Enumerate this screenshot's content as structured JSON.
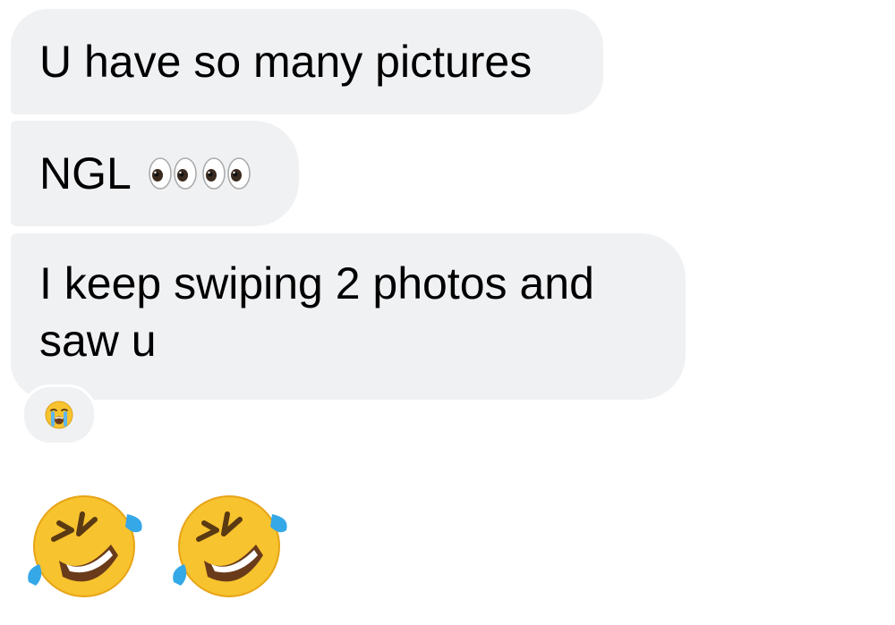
{
  "messages": [
    {
      "text": "U have so many pictures"
    },
    {
      "text": "NGL",
      "emojis": [
        "eyes-emoji",
        "eyes-emoji"
      ]
    },
    {
      "text": "I keep swiping 2 photos and saw u"
    }
  ],
  "reaction": {
    "emoji": "loudly-crying-face-emoji"
  },
  "emoji_message": {
    "emojis": [
      "rolling-on-floor-laughing-emoji",
      "rolling-on-floor-laughing-emoji"
    ]
  },
  "colors": {
    "bubble_bg": "#f0f1f3",
    "text": "#000000",
    "emoji_yellow": "#f7c32e",
    "tear_blue": "#35a8e8"
  }
}
